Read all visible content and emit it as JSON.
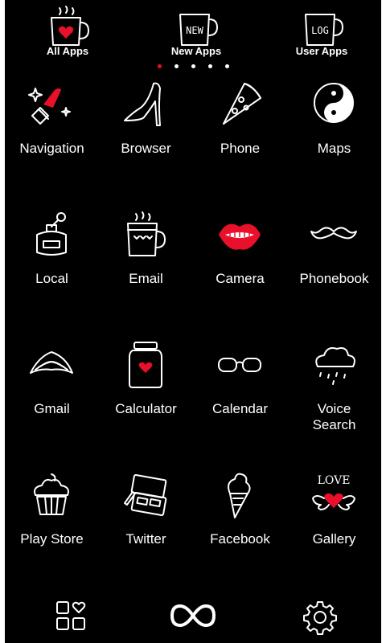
{
  "tabs": [
    {
      "label": "All Apps",
      "mug_text": ""
    },
    {
      "label": "New Apps",
      "mug_text": "NEW"
    },
    {
      "label": "User Apps",
      "mug_text": "LOG"
    }
  ],
  "page_indicator": {
    "pages": 5,
    "active_page": 1
  },
  "apps": [
    {
      "label": "Navigation",
      "icon": "lipstick-icon"
    },
    {
      "label": "Browser",
      "icon": "high-heel-icon"
    },
    {
      "label": "Phone",
      "icon": "pizza-slice-icon"
    },
    {
      "label": "Maps",
      "icon": "yin-yang-icon"
    },
    {
      "label": "Local",
      "icon": "perfume-bottle-icon"
    },
    {
      "label": "Email",
      "icon": "coffee-mug-icon"
    },
    {
      "label": "Camera",
      "icon": "red-lips-icon"
    },
    {
      "label": "Phonebook",
      "icon": "mustache-icon"
    },
    {
      "label": "Gmail",
      "icon": "wings-icon"
    },
    {
      "label": "Calculator",
      "icon": "heart-jar-icon"
    },
    {
      "label": "Calendar",
      "icon": "glasses-icon"
    },
    {
      "label": "Voice Search",
      "label_line1": "Voice",
      "label_line2": "Search",
      "icon": "rain-cloud-icon"
    },
    {
      "label": "Play Store",
      "icon": "cupcake-icon"
    },
    {
      "label": "Twitter",
      "icon": "makeup-palette-icon"
    },
    {
      "label": "Facebook",
      "icon": "ice-cream-cone-icon"
    },
    {
      "label": "Gallery",
      "icon": "love-wings-icon",
      "icon_text": "LOVE"
    }
  ],
  "dock": [
    {
      "icon": "app-drawer-icon"
    },
    {
      "icon": "infinity-icon"
    },
    {
      "icon": "settings-gear-icon"
    }
  ],
  "colors": {
    "background": "#000000",
    "foreground": "#ffffff",
    "accent": "#e8102a"
  }
}
